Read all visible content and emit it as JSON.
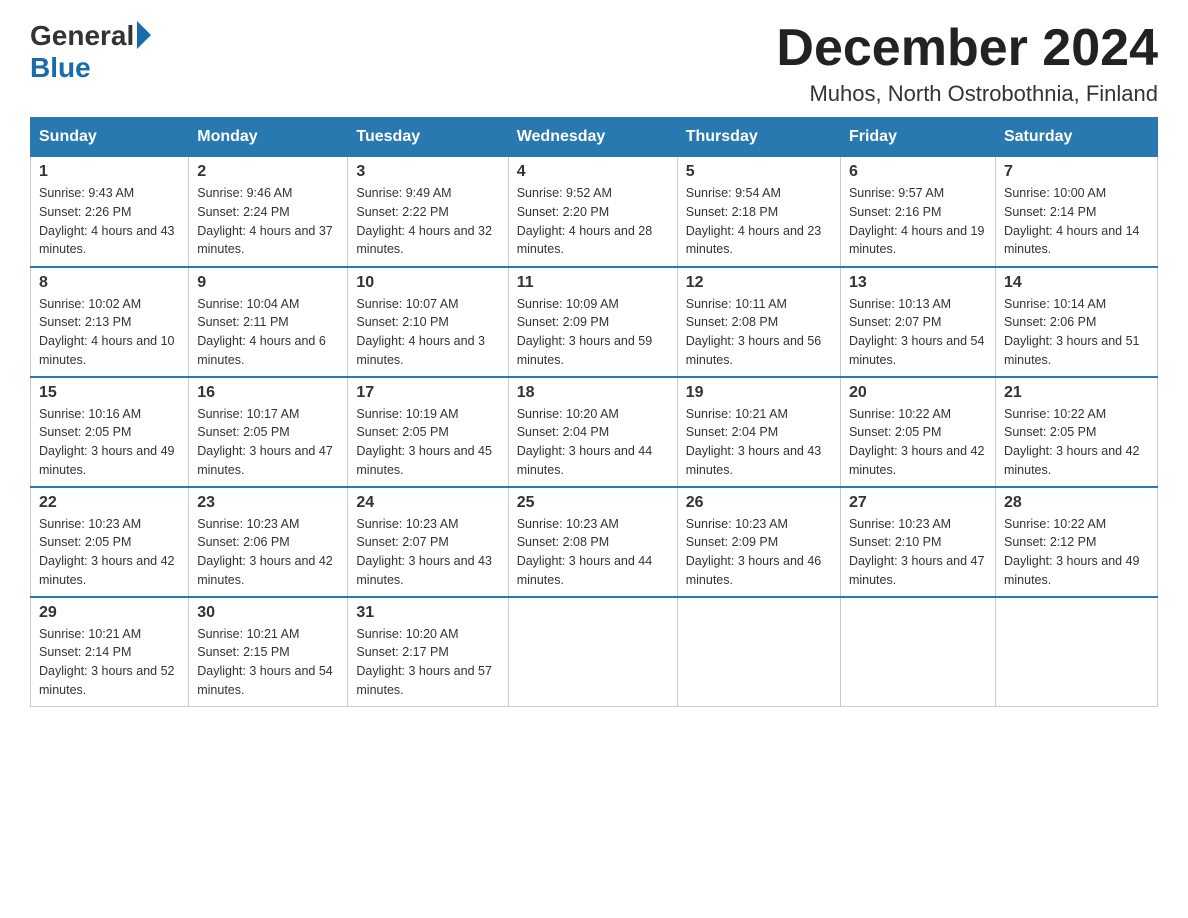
{
  "logo": {
    "general": "General",
    "blue": "Blue"
  },
  "title": "December 2024",
  "location": "Muhos, North Ostrobothnia, Finland",
  "headers": [
    "Sunday",
    "Monday",
    "Tuesday",
    "Wednesday",
    "Thursday",
    "Friday",
    "Saturday"
  ],
  "weeks": [
    [
      {
        "day": "1",
        "sunrise": "9:43 AM",
        "sunset": "2:26 PM",
        "daylight": "4 hours and 43 minutes."
      },
      {
        "day": "2",
        "sunrise": "9:46 AM",
        "sunset": "2:24 PM",
        "daylight": "4 hours and 37 minutes."
      },
      {
        "day": "3",
        "sunrise": "9:49 AM",
        "sunset": "2:22 PM",
        "daylight": "4 hours and 32 minutes."
      },
      {
        "day": "4",
        "sunrise": "9:52 AM",
        "sunset": "2:20 PM",
        "daylight": "4 hours and 28 minutes."
      },
      {
        "day": "5",
        "sunrise": "9:54 AM",
        "sunset": "2:18 PM",
        "daylight": "4 hours and 23 minutes."
      },
      {
        "day": "6",
        "sunrise": "9:57 AM",
        "sunset": "2:16 PM",
        "daylight": "4 hours and 19 minutes."
      },
      {
        "day": "7",
        "sunrise": "10:00 AM",
        "sunset": "2:14 PM",
        "daylight": "4 hours and 14 minutes."
      }
    ],
    [
      {
        "day": "8",
        "sunrise": "10:02 AM",
        "sunset": "2:13 PM",
        "daylight": "4 hours and 10 minutes."
      },
      {
        "day": "9",
        "sunrise": "10:04 AM",
        "sunset": "2:11 PM",
        "daylight": "4 hours and 6 minutes."
      },
      {
        "day": "10",
        "sunrise": "10:07 AM",
        "sunset": "2:10 PM",
        "daylight": "4 hours and 3 minutes."
      },
      {
        "day": "11",
        "sunrise": "10:09 AM",
        "sunset": "2:09 PM",
        "daylight": "3 hours and 59 minutes."
      },
      {
        "day": "12",
        "sunrise": "10:11 AM",
        "sunset": "2:08 PM",
        "daylight": "3 hours and 56 minutes."
      },
      {
        "day": "13",
        "sunrise": "10:13 AM",
        "sunset": "2:07 PM",
        "daylight": "3 hours and 54 minutes."
      },
      {
        "day": "14",
        "sunrise": "10:14 AM",
        "sunset": "2:06 PM",
        "daylight": "3 hours and 51 minutes."
      }
    ],
    [
      {
        "day": "15",
        "sunrise": "10:16 AM",
        "sunset": "2:05 PM",
        "daylight": "3 hours and 49 minutes."
      },
      {
        "day": "16",
        "sunrise": "10:17 AM",
        "sunset": "2:05 PM",
        "daylight": "3 hours and 47 minutes."
      },
      {
        "day": "17",
        "sunrise": "10:19 AM",
        "sunset": "2:05 PM",
        "daylight": "3 hours and 45 minutes."
      },
      {
        "day": "18",
        "sunrise": "10:20 AM",
        "sunset": "2:04 PM",
        "daylight": "3 hours and 44 minutes."
      },
      {
        "day": "19",
        "sunrise": "10:21 AM",
        "sunset": "2:04 PM",
        "daylight": "3 hours and 43 minutes."
      },
      {
        "day": "20",
        "sunrise": "10:22 AM",
        "sunset": "2:05 PM",
        "daylight": "3 hours and 42 minutes."
      },
      {
        "day": "21",
        "sunrise": "10:22 AM",
        "sunset": "2:05 PM",
        "daylight": "3 hours and 42 minutes."
      }
    ],
    [
      {
        "day": "22",
        "sunrise": "10:23 AM",
        "sunset": "2:05 PM",
        "daylight": "3 hours and 42 minutes."
      },
      {
        "day": "23",
        "sunrise": "10:23 AM",
        "sunset": "2:06 PM",
        "daylight": "3 hours and 42 minutes."
      },
      {
        "day": "24",
        "sunrise": "10:23 AM",
        "sunset": "2:07 PM",
        "daylight": "3 hours and 43 minutes."
      },
      {
        "day": "25",
        "sunrise": "10:23 AM",
        "sunset": "2:08 PM",
        "daylight": "3 hours and 44 minutes."
      },
      {
        "day": "26",
        "sunrise": "10:23 AM",
        "sunset": "2:09 PM",
        "daylight": "3 hours and 46 minutes."
      },
      {
        "day": "27",
        "sunrise": "10:23 AM",
        "sunset": "2:10 PM",
        "daylight": "3 hours and 47 minutes."
      },
      {
        "day": "28",
        "sunrise": "10:22 AM",
        "sunset": "2:12 PM",
        "daylight": "3 hours and 49 minutes."
      }
    ],
    [
      {
        "day": "29",
        "sunrise": "10:21 AM",
        "sunset": "2:14 PM",
        "daylight": "3 hours and 52 minutes."
      },
      {
        "day": "30",
        "sunrise": "10:21 AM",
        "sunset": "2:15 PM",
        "daylight": "3 hours and 54 minutes."
      },
      {
        "day": "31",
        "sunrise": "10:20 AM",
        "sunset": "2:17 PM",
        "daylight": "3 hours and 57 minutes."
      },
      null,
      null,
      null,
      null
    ]
  ]
}
